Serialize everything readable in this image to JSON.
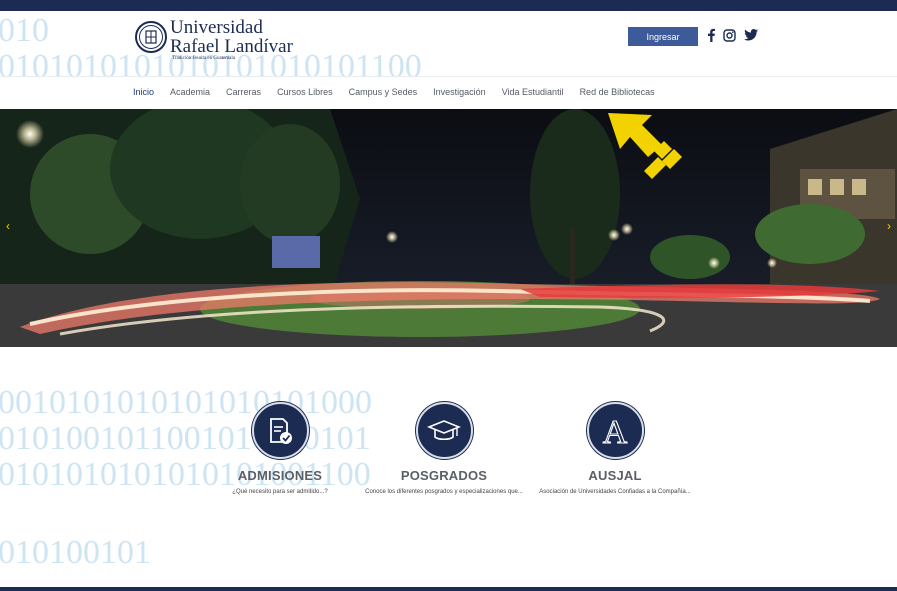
{
  "background_binary": [
    "010",
    "0101010101010101010101100",
    "0010101010101010101000",
    "0101001011001010010101",
    "0101010101010101001100",
    "010100101"
  ],
  "header": {
    "logo": {
      "line1": "Universidad",
      "line2": "Rafael Landívar",
      "tagline": "Tradición Jesuita en Guatemala"
    },
    "login_label": "Ingresar",
    "social": [
      "facebook-icon",
      "instagram-icon",
      "twitter-icon"
    ]
  },
  "nav": {
    "items": [
      {
        "label": "Inicio",
        "active": true
      },
      {
        "label": "Academia"
      },
      {
        "label": "Carreras"
      },
      {
        "label": "Cursos Libres"
      },
      {
        "label": "Campus y Sedes"
      },
      {
        "label": "Investigación"
      },
      {
        "label": "Vida Estudiantil"
      },
      {
        "label": "Red de Bibliotecas"
      }
    ]
  },
  "cards": [
    {
      "title": "ADMISIONES",
      "desc": "¿Qué necesito para ser admitido...?",
      "icon": "document-check-icon"
    },
    {
      "title": "POSGRADOS",
      "desc": "Conoce los diferentes posgrados y especializaciones que...",
      "icon": "graduation-cap-icon"
    },
    {
      "title": "AUSJAL",
      "desc": "Asociación de Universidades Confiadas a la Compañía...",
      "icon": "letter-a-icon"
    }
  ],
  "colors": {
    "navy": "#1c2b52",
    "button": "#3d5a99",
    "annotation_arrow": "#f2d200",
    "binary": "#cde4f3"
  }
}
